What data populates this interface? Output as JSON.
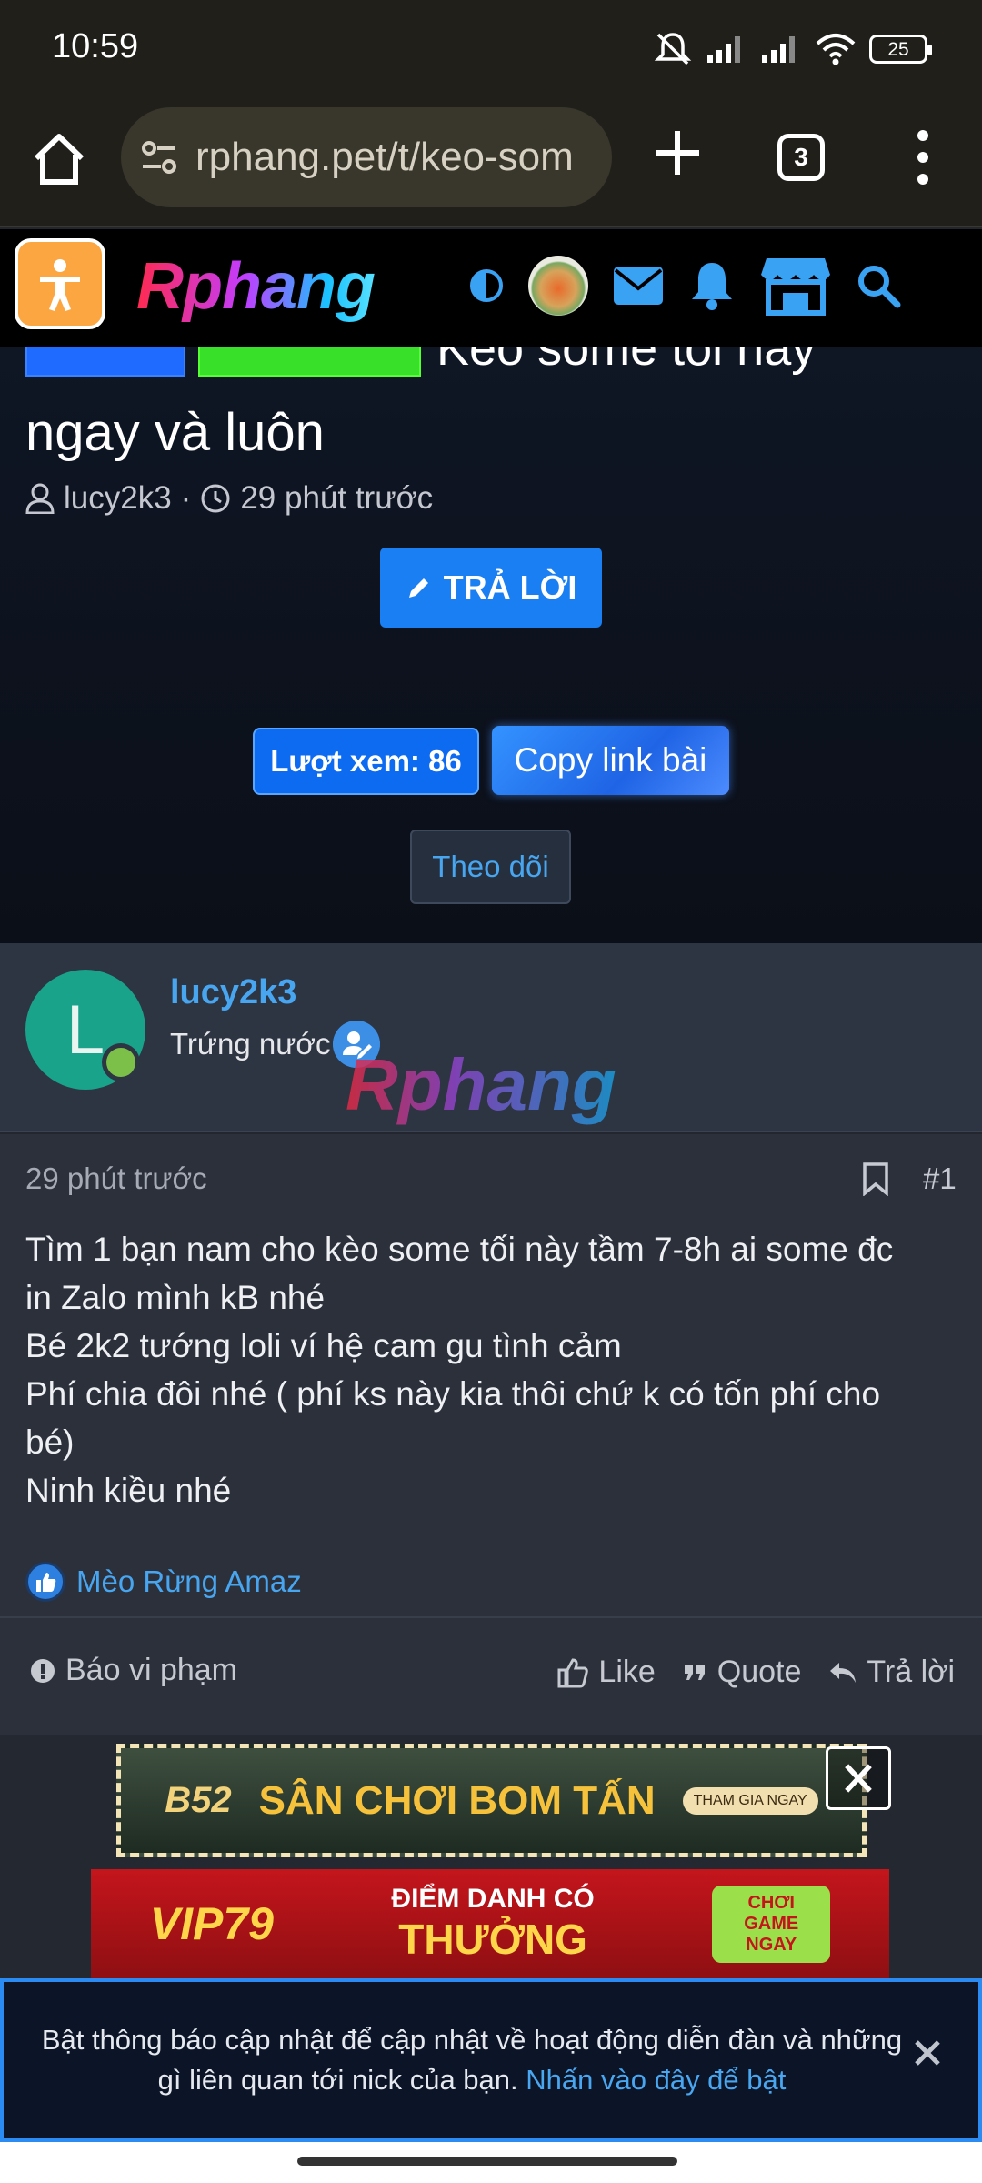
{
  "status_bar": {
    "time": "10:59",
    "battery": "25"
  },
  "browser": {
    "url": "rphang.pet/t/keo-som",
    "tab_count": "3"
  },
  "site": {
    "logo_text": "Rphang",
    "watermark_text": "Rphang"
  },
  "thread": {
    "title_line1": "Kèo some tối nay",
    "title_line2": "ngay và luôn",
    "author": "lucy2k3",
    "separator": "·",
    "time": "29 phút trước",
    "reply_button": "TRẢ LỜI",
    "views_label": "Lượt xem: 86",
    "copy_link_button": "Copy link bài",
    "follow_button": "Theo dõi"
  },
  "post": {
    "author_initial": "L",
    "author_name": "lucy2k3",
    "author_rank": "Trứng nước",
    "time": "29 phút trước",
    "number": "#1",
    "lines": [
      "Tìm 1 bạn nam cho kèo some tối này tầm 7-8h ai some đc",
      "in Zalo mình kB nhé",
      "Bé 2k2 tướng loli ví hệ cam gu tình cảm",
      "Phí chia đôi nhé ( phí ks này kia thôi chứ k có tốn phí cho",
      "bé)",
      "Ninh kiều nhé"
    ],
    "reaction_user": "Mèo Rừng Amaz",
    "actions": {
      "report": "Báo vi phạm",
      "like": "Like",
      "quote": "Quote",
      "reply": "Trả lời"
    }
  },
  "ads": {
    "ad1_brand": "B52",
    "ad1_text": "SÂN CHƠI BOM TẤN",
    "ad1_cta": "THAM GIA NGAY",
    "ad2_brand": "VIP79",
    "ad2_line1": "ĐIỂM DANH CÓ",
    "ad2_line2": "THƯỞNG",
    "ad2_cta": "CHƠI GAME NGAY"
  },
  "notice": {
    "text": "Bật thông báo cập nhật để cập nhật về hoạt động diễn đàn và những gì liên quan tới nick của bạn.",
    "link": "Nhấn vào đây để bật"
  },
  "colors": {
    "accent": "#1a7ff2",
    "link": "#48a6f0",
    "header_bg": "#000000",
    "post_bg": "#2b303b"
  }
}
